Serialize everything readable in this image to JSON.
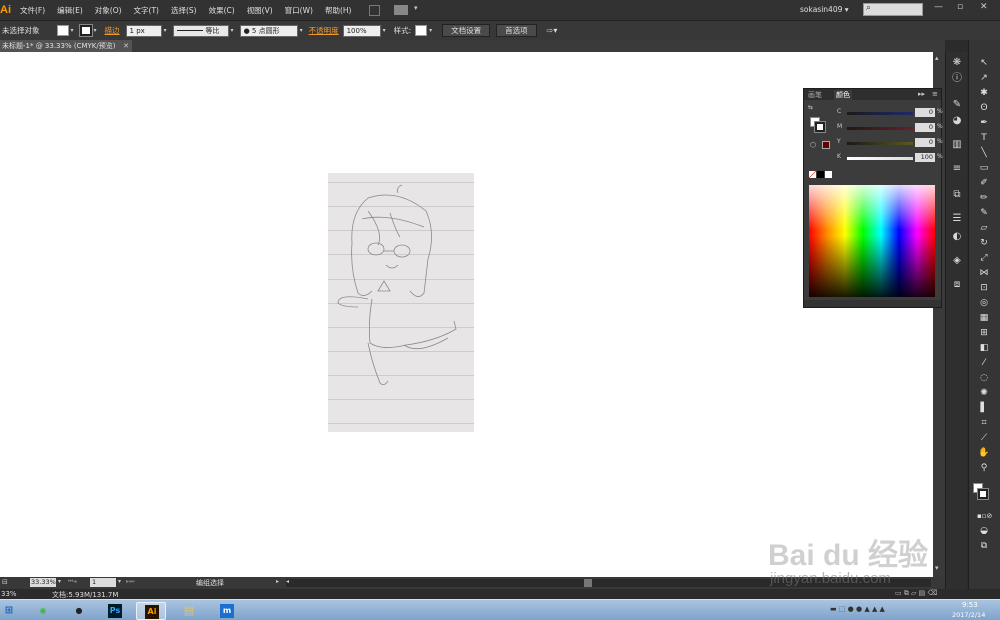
{
  "app": {
    "logo": "Ai"
  },
  "menu": {
    "items": [
      "文件(F)",
      "编辑(E)",
      "对象(O)",
      "文字(T)",
      "选择(S)",
      "效果(C)",
      "视图(V)",
      "窗口(W)",
      "帮助(H)"
    ]
  },
  "user": {
    "name": "sokasin409 ▾"
  },
  "window_controls": {
    "minimize": "—",
    "restore": "▫",
    "close": "✕"
  },
  "control_bar": {
    "selection_label": "未选择对象",
    "stroke_label": "描边",
    "stroke_weight": "1 px",
    "stroke_profile": "等比",
    "brush": "● 5 点圆形",
    "opacity_label": "不透明度",
    "opacity_value": "100%",
    "style_label": "样式:",
    "doc_setup_button": "文档设置",
    "preferences_button": "首选项"
  },
  "document_tab": {
    "title": "未标题-1* @ 33.33% (CMYK/预览)",
    "close": "✕"
  },
  "color_panel": {
    "tab1": "画笔",
    "tab2": "颜色",
    "channels": [
      {
        "label": "C",
        "value": "0",
        "unit": "%",
        "color": "#2a2f6a"
      },
      {
        "label": "M",
        "value": "0",
        "unit": "%",
        "color": "#6a1e2a"
      },
      {
        "label": "Y",
        "value": "0",
        "unit": "%",
        "color": "#5a5a1e"
      },
      {
        "label": "K",
        "value": "100",
        "unit": "%",
        "color": "#dcdcdc"
      }
    ]
  },
  "status_bar": {
    "zoom": "33.33%",
    "page": "1",
    "tool_status": "编组选择",
    "doc_size": "文档:5.93M/131.7M",
    "zoom2": "33%"
  },
  "taskbar": {
    "clock_time": "9:53",
    "clock_date": "2017/2/14",
    "apps": [
      {
        "name": "wechat-icon",
        "glyph": "◉",
        "color": "#3fb838"
      },
      {
        "name": "qq-icon",
        "glyph": "●",
        "color": "#222222"
      },
      {
        "name": "photoshop-icon",
        "glyph": "Ps",
        "color": "#31a8ff"
      },
      {
        "name": "illustrator-icon",
        "glyph": "Ai",
        "color": "#ff9a00"
      },
      {
        "name": "folder-icon",
        "glyph": "▤",
        "color": "#e6c35c"
      },
      {
        "name": "maxthon-icon",
        "glyph": "m",
        "color": "#1a6fd1"
      }
    ]
  },
  "watermark": {
    "brand": "Bai du 经验",
    "url": "jingyan.baidu.com"
  },
  "colors": {
    "accent": "#ff9a00",
    "canvas": "#ffffff",
    "panel": "#3c3c3c"
  }
}
